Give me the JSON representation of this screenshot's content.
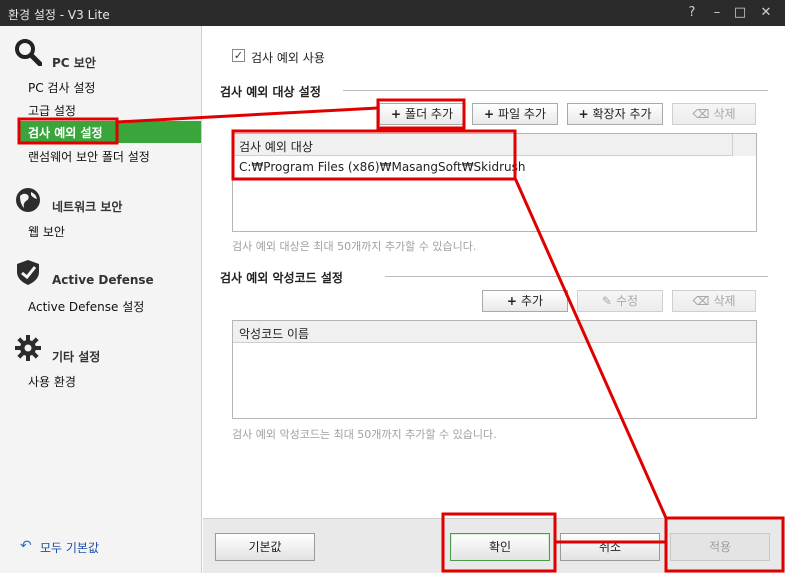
{
  "window": {
    "title": "환경 설정 - V3 Lite",
    "help": "?",
    "minimize": "–",
    "maximize": "□",
    "close": "✕"
  },
  "sidebar": {
    "sections": [
      {
        "icon": "magnifier-icon",
        "title": "PC 보안",
        "items": [
          "PC 검사 설정",
          "고급 설정",
          "검사 예외 설정",
          "랜섬웨어 보안 폴더 설정"
        ]
      },
      {
        "icon": "globe-icon",
        "title": "네트워크 보안",
        "items": [
          "웹 보안"
        ]
      },
      {
        "icon": "shield-icon",
        "title": "Active Defense",
        "items": [
          "Active Defense 설정"
        ]
      },
      {
        "icon": "gear-icon",
        "title": "기타 설정",
        "items": [
          "사용 환경"
        ]
      }
    ],
    "active_item": "검사 예외 설정",
    "reset_all": "모두 기본값"
  },
  "exclusion": {
    "enable_checkbox_label": "검사 예외 사용",
    "enable_checked": true,
    "targets_section_title": "검사 예외 대상 설정",
    "add_folder": "폴더 추가",
    "add_file": "파일 추가",
    "add_extension": "확장자 추가",
    "delete": "삭제",
    "targets_column": "검사 예외 대상",
    "targets": [
      "C:₩Program Files (x86)₩MasangSoft₩Skidrush"
    ],
    "targets_hint": "검사 예외 대상은 최대 50개까지 추가할 수 있습니다.",
    "malware_section_title": "검사 예외 악성코드 설정",
    "add": "추가",
    "edit": "수정",
    "malware_delete": "삭제",
    "malware_column": "악성코드 이름",
    "malware_hint": "검사 예외 악성코드는 최대 50개까지 추가할 수 있습니다."
  },
  "footer": {
    "default": "기본값",
    "ok": "확인",
    "cancel": "취소",
    "apply": "적용"
  },
  "colors": {
    "titlebar": "#2b2b2b",
    "active_item": "#3aa53a",
    "annotation": "#e00000"
  }
}
